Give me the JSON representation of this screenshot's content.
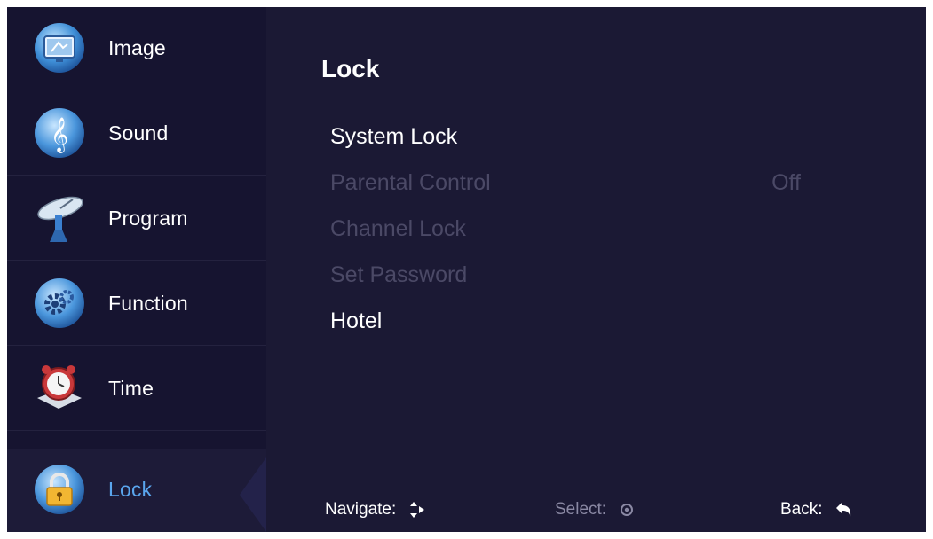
{
  "sidebar": {
    "items": [
      {
        "label": "Image",
        "icon": "monitor-icon"
      },
      {
        "label": "Sound",
        "icon": "music-note-icon"
      },
      {
        "label": "Program",
        "icon": "satellite-dish-icon"
      },
      {
        "label": "Function",
        "icon": "gear-icon"
      },
      {
        "label": "Time",
        "icon": "alarm-clock-icon"
      },
      {
        "label": "Lock",
        "icon": "padlock-icon",
        "active": true
      }
    ]
  },
  "main": {
    "title": "Lock",
    "items": [
      {
        "label": "System Lock",
        "enabled": true
      },
      {
        "label": "Parental Control",
        "value": "Off",
        "enabled": false
      },
      {
        "label": "Channel Lock",
        "enabled": false
      },
      {
        "label": "Set Password",
        "enabled": false
      },
      {
        "label": "Hotel",
        "enabled": true
      }
    ]
  },
  "footer": {
    "navigate": "Navigate:",
    "select": "Select:",
    "back": "Back:"
  },
  "colors": {
    "background": "#1b1934",
    "sidebar": "#161430",
    "active_label": "#5aa6ee",
    "disabled_text": "#4b4966"
  }
}
